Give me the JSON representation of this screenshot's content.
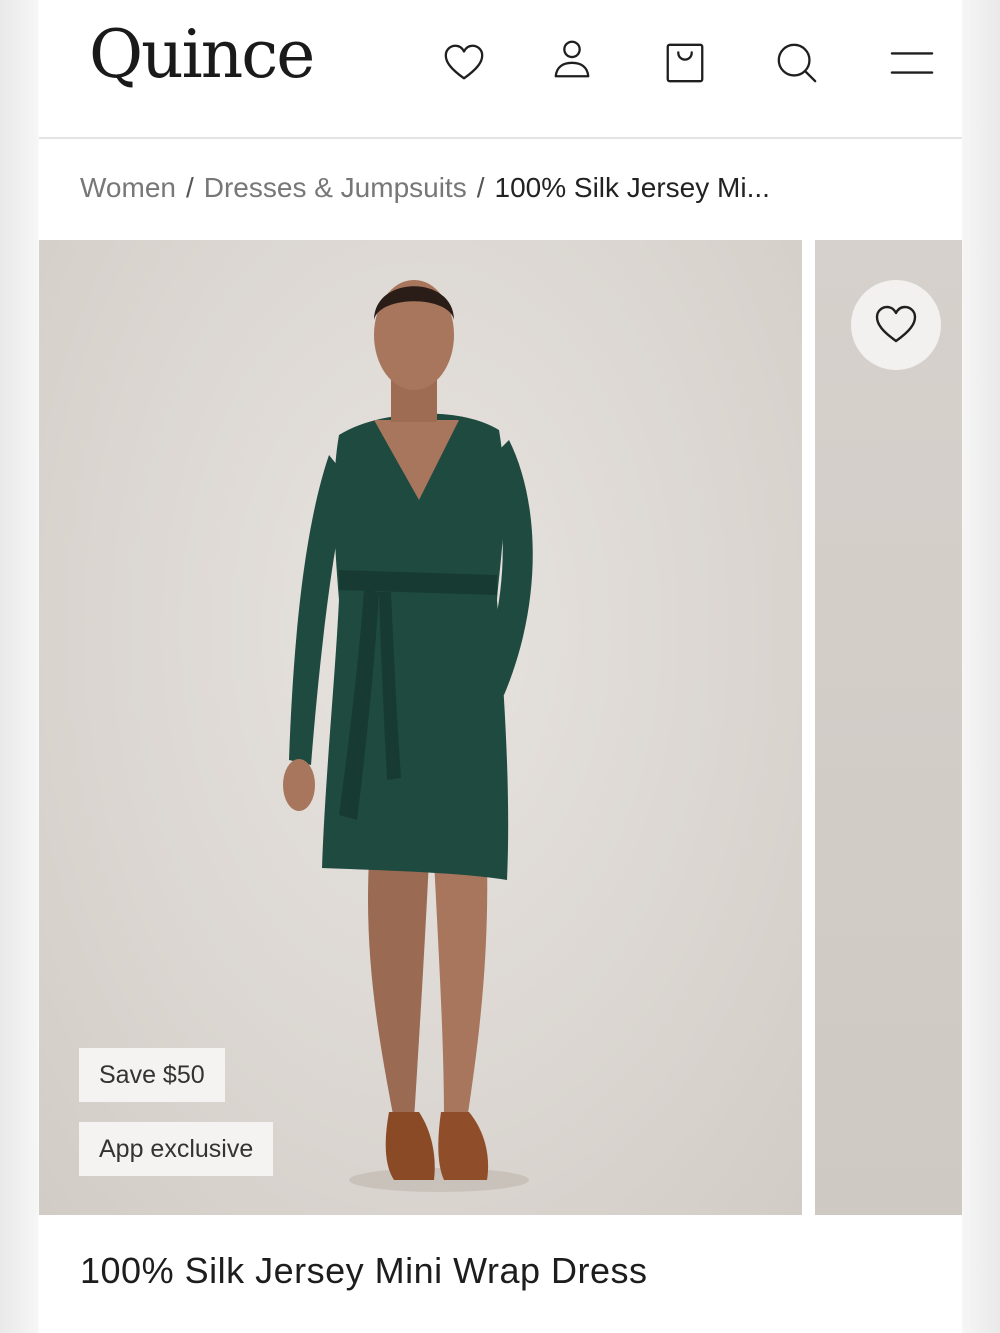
{
  "header": {
    "logo": "Quince",
    "icons": [
      "heart-icon",
      "account-icon",
      "shopping-bag-icon",
      "search-icon",
      "menu-icon"
    ]
  },
  "breadcrumb": {
    "items": [
      "Women",
      "Dresses & Jumpsuits"
    ],
    "current": "100% Silk Jersey Mi...",
    "separator": "/"
  },
  "gallery": {
    "badges": [
      "Save $50",
      "App exclusive"
    ],
    "favorite_icon": "heart-icon"
  },
  "product": {
    "title": "100% Silk Jersey Mini Wrap Dress"
  },
  "colors": {
    "dress": "#1f4a40",
    "background": "#ddd8d3",
    "badge_bg": "#f4f3f1",
    "text": "#222222"
  }
}
